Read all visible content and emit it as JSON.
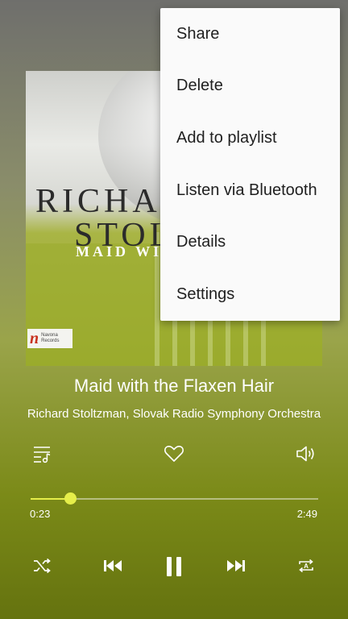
{
  "album_art": {
    "line1": "RICHAR",
    "line2": "STOL",
    "line3": "MAID WIT",
    "label_mark": "n",
    "label_text": "Navona Records"
  },
  "track": {
    "title": "Maid with the Flaxen Hair",
    "artist": "Richard Stoltzman, Slovak Radio Symphony Orchestra"
  },
  "progress": {
    "elapsed": "0:23",
    "duration": "2:49",
    "fraction": 0.136
  },
  "menu": {
    "items": [
      {
        "label": "Share"
      },
      {
        "label": "Delete"
      },
      {
        "label": "Add to playlist"
      },
      {
        "label": "Listen via Bluetooth"
      },
      {
        "label": "Details"
      },
      {
        "label": "Settings"
      }
    ]
  },
  "icons": {
    "queue": "playlist-icon",
    "favorite": "heart-icon",
    "volume": "volume-icon",
    "shuffle": "shuffle-icon",
    "previous": "skip-previous-icon",
    "play_pause": "pause-icon",
    "next": "skip-next-icon",
    "repeat": "repeat-a-icon"
  },
  "colors": {
    "accent": "#e6ee4a",
    "menu_bg": "#fafafa",
    "menu_text": "#1f1f1f"
  }
}
